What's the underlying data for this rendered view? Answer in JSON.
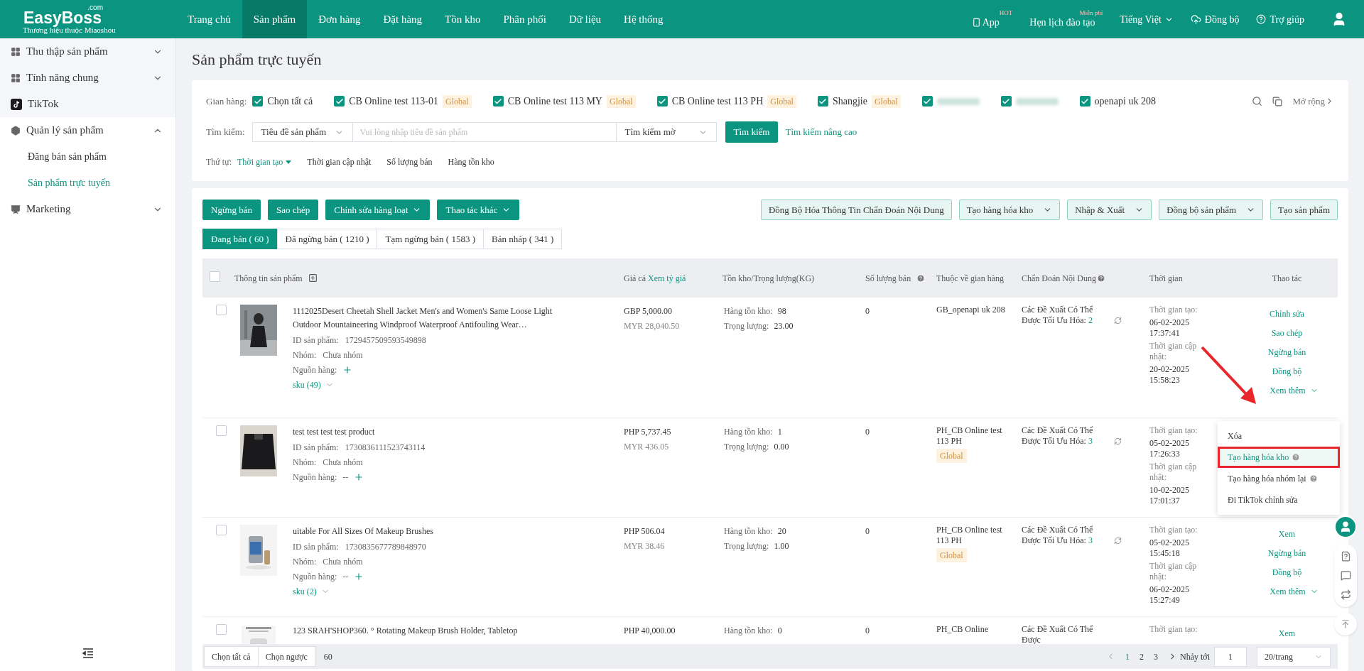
{
  "nav": {
    "logo": "EasyBoss",
    "logo_suffix": ".com",
    "tagline": "Thương hiệu thuộc Miaoshou",
    "items": [
      {
        "label": "Trang chủ",
        "selected": false
      },
      {
        "label": "Sản phẩm",
        "selected": true
      },
      {
        "label": "Đơn hàng",
        "selected": false
      },
      {
        "label": "Đặt hàng",
        "selected": false
      },
      {
        "label": "Tồn kho",
        "selected": false
      },
      {
        "label": "Phân phối",
        "selected": false
      },
      {
        "label": "Dữ liệu",
        "selected": false
      },
      {
        "label": "Hệ thống",
        "selected": false
      }
    ],
    "app": {
      "label": "App",
      "badge": "HOT"
    },
    "training": {
      "label": "Hẹn lịch đào tạo",
      "badge": "Miễn phí"
    },
    "language": "Tiếng Việt",
    "sync": "Đồng bộ",
    "help": "Trợ giúp"
  },
  "sidebar": {
    "items": [
      {
        "label": "Thu thập sản phẩm",
        "expanded": false
      },
      {
        "label": "Tính năng chung",
        "expanded": false
      },
      {
        "label": "TikTok"
      },
      {
        "label": "Quản lý sản phẩm",
        "expanded": true,
        "children": [
          {
            "label": "Đăng bán sản phẩm",
            "selected": false
          },
          {
            "label": "Sản phẩm trực tuyến",
            "selected": true
          }
        ]
      },
      {
        "label": "Marketing",
        "expanded": false
      }
    ]
  },
  "page_title": "Sản phẩm trực tuyến",
  "filters": {
    "store_label": "Gian hàng:",
    "stores": [
      {
        "kind": "store",
        "label": "Chọn tất cả",
        "checked": true
      },
      {
        "kind": "store",
        "label": "CB Online test 113-01",
        "tag": "Global",
        "checked": true
      },
      {
        "kind": "store",
        "label": "CB Online test 113 MY",
        "tag": "Global",
        "checked": true
      },
      {
        "kind": "store",
        "label": "CB Online test 113 PH",
        "tag": "Global",
        "checked": true
      },
      {
        "kind": "store",
        "label": "Shangjie",
        "tag": "Global",
        "checked": true
      },
      {
        "kind": "blurred",
        "checked": true
      },
      {
        "kind": "blurred",
        "checked": true
      },
      {
        "kind": "store",
        "label": "openapi uk 208",
        "checked": true
      }
    ],
    "expand": "Mở rộng",
    "search_label": "Tìm kiếm:",
    "search_field": "Tiêu đề sản phẩm",
    "search": {
      "placeholder": "Vui lòng nhập tiêu đề sản phẩm"
    },
    "search_mode": "Tìm kiếm mờ",
    "search_button": "Tìm kiếm",
    "advanced": "Tìm kiếm nâng cao",
    "sort_label": "Thứ tự:",
    "sort": [
      {
        "label": "Thời gian tạo",
        "selected": true
      },
      {
        "label": "Thời gian cập nhật",
        "selected": false
      },
      {
        "label": "Số lượng bán",
        "selected": false
      },
      {
        "label": "Hàng tồn kho",
        "selected": false
      }
    ]
  },
  "toolbar": {
    "left": [
      {
        "label": "Ngừng bán",
        "dropdown": false
      },
      {
        "label": "Sao chép",
        "dropdown": false
      },
      {
        "label": "Chỉnh sửa hàng loạt",
        "dropdown": true
      },
      {
        "label": "Thao tác khác",
        "dropdown": true
      }
    ],
    "right": [
      {
        "label": "Đồng Bộ Hóa Thông Tin Chẩn Đoán Nội Dung",
        "dropdown": false
      },
      {
        "label": "Tạo hàng hóa kho",
        "dropdown": true
      },
      {
        "label": "Nhập & Xuất",
        "dropdown": true
      },
      {
        "label": "Đồng bộ sản phẩm",
        "dropdown": true
      },
      {
        "label": "Tạo sản phẩm",
        "dropdown": false
      }
    ]
  },
  "tabs": [
    {
      "label": "Đang bán ( 60 )",
      "selected": true
    },
    {
      "label": "Đã ngừng bán ( 1210 )",
      "selected": false
    },
    {
      "label": "Tạm ngừng bán ( 1583 )",
      "selected": false
    },
    {
      "label": "Bản nháp ( 341 )",
      "selected": false
    }
  ],
  "table": {
    "select_all_checked": false,
    "columns": {
      "product": "Thông tin sản phẩm",
      "price": "Giá cả",
      "price_link": "Xem tỷ giá",
      "stock": "Tồn kho/Trọng lượng(KG)",
      "sold": "Số lượng bán",
      "store": "Thuộc về gian hàng",
      "diagnosis": "Chẩn Đoán Nội Dung",
      "time": "Thời gian",
      "actions": "Thao tác"
    },
    "rows": [
      {
        "checked": false,
        "title": "1112025Desert Cheetah Shell Jacket Men's and Women's Same Loose Light Outdoor Mountaineering Windproof Waterproof Antifouling Wear…",
        "id_label": "ID sản phẩm:",
        "id": "1729457509593549898",
        "group_label": "Nhóm:",
        "group": "Chưa nhóm",
        "source_label": "Nguồn hàng:",
        "sku": "sku (49)",
        "price": "GBP 5,000.00",
        "price_alt": "MYR 28,040.50",
        "stock_label": "Hàng tồn kho:",
        "stock": "98",
        "weight_label": "Trọng lượng:",
        "weight": "23.00",
        "sold": "0",
        "store": "GB_openapi uk 208",
        "diag_label": "Các Đề Xuất Có Thể Được Tối Ưu Hóa:",
        "diag_count": "2",
        "created_label": "Thời gian tạo:",
        "created": "06-02-2025 17:37:41",
        "updated_label": "Thời gian cập nhật:",
        "updated": "20-02-2025 15:58:23",
        "actions": [
          "Chỉnh sửa",
          "Sao chép",
          "Ngừng bán",
          "Đồng bộ"
        ],
        "more": "Xem thêm"
      },
      {
        "checked": false,
        "title": "test test test test product",
        "id_label": "ID sản phẩm:",
        "id": "1730836111523743114",
        "group_label": "Nhóm:",
        "group": "Chưa nhóm",
        "source_label": "Nguồn hàng:",
        "source": "--",
        "price": "PHP 5,737.45",
        "price_alt": "MYR 436.05",
        "stock_label": "Hàng tồn kho:",
        "stock": "1",
        "weight_label": "Trọng lượng:",
        "weight": "0.00",
        "sold": "0",
        "store": "PH_CB Online test 113 PH",
        "store_tag": "Global",
        "diag_label": "Các Đề Xuất Có Thể Được Tối Ưu Hóa:",
        "diag_count": "3",
        "created_label": "Thời gian tạo:",
        "created": "05-02-2025 17:26:33",
        "updated_label": "Thời gian cập nhật:",
        "updated": "10-02-2025 17:01:37"
      },
      {
        "checked": false,
        "title": "uitable For All Sizes Of Makeup Brushes",
        "id_label": "ID sản phẩm:",
        "id": "1730835677789848970",
        "group_label": "Nhóm:",
        "group": "Chưa nhóm",
        "source_label": "Nguồn hàng:",
        "source": "--",
        "sku": "sku (2)",
        "price": "PHP 506.04",
        "price_alt": "MYR 38.46",
        "stock_label": "Hàng tồn kho:",
        "stock": "20",
        "weight_label": "Trọng lượng:",
        "weight": "1.00",
        "sold": "0",
        "store": "PH_CB Online test 113 PH",
        "store_tag": "Global",
        "diag_label": "Các Đề Xuất Có Thể Được Tối Ưu Hóa:",
        "diag_count": "3",
        "created_label": "Thời gian tạo:",
        "created": "05-02-2025 15:45:18",
        "updated_label": "Thời gian cập nhật:",
        "updated": "06-02-2025 15:27:49",
        "actions": [
          "Xem",
          "Ngừng bán",
          "Đồng bộ"
        ],
        "more": "Xem thêm"
      },
      {
        "checked": false,
        "title": "123 SRAH'SHOP360. ° Rotating Makeup Brush Holder, Tabletop",
        "price": "PHP 40,000.00",
        "stock_label": "Hàng tồn kho:",
        "stock": "0",
        "sold": "0",
        "store": "PH_CB Online",
        "diag_label": "Các Đề Xuất Có Thể Được",
        "created_label": "Thời gian tạo:",
        "actions": [
          "Xem"
        ]
      }
    ]
  },
  "menu": [
    {
      "label": "Xóa",
      "help": false,
      "selected": false
    },
    {
      "label": "Tạo hàng hóa kho",
      "help": true,
      "selected": true
    },
    {
      "label": "Tạo hàng hóa nhóm lại",
      "help": true,
      "selected": false
    },
    {
      "label": "Đi TikTok chỉnh sửa",
      "help": false,
      "selected": false
    }
  ],
  "footer": {
    "select_all": "Chọn tất cả",
    "invert": "Chọn ngược",
    "count": "60",
    "pages": [
      {
        "label": "1",
        "selected": true
      },
      {
        "label": "2",
        "selected": false
      },
      {
        "label": "3",
        "selected": false
      }
    ],
    "jump_label": "Nhảy tới",
    "jump_value": "1",
    "page_size": "20/trang"
  }
}
